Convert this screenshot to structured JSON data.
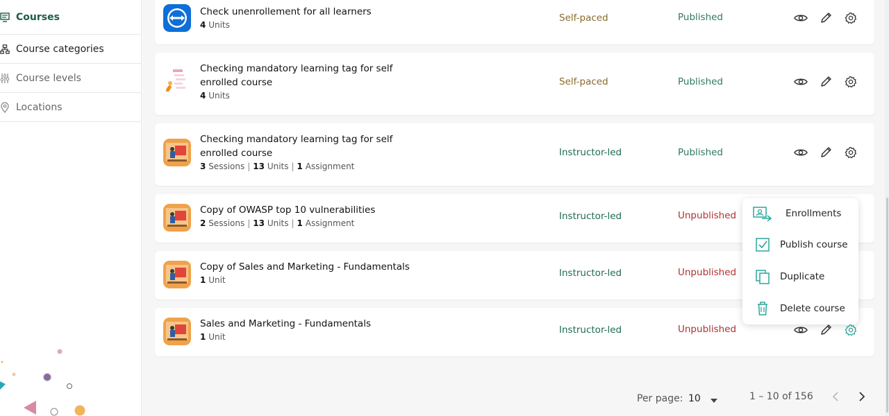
{
  "sidebar": {
    "items": [
      {
        "label": "Courses",
        "icon": "courses-icon",
        "active": true
      },
      {
        "label": "Course categories",
        "icon": "categories-icon"
      },
      {
        "label": "Course levels",
        "icon": "levels-icon"
      },
      {
        "label": "Locations",
        "icon": "location-pin-icon"
      }
    ]
  },
  "courses": [
    {
      "title": "Check unenrollement for all learners",
      "meta": [
        {
          "n": "4",
          "t": "Units"
        }
      ],
      "type": "Self-paced",
      "status": "Published",
      "icon": "teamviewer-logo"
    },
    {
      "title": "Checking mandatory learning tag for self enrolled course",
      "meta": [
        {
          "n": "4",
          "t": "Units"
        }
      ],
      "type": "Self-paced",
      "status": "Published",
      "icon": "document-illustration"
    },
    {
      "title": "Checking mandatory learning tag for self enrolled course",
      "meta": [
        {
          "n": "3",
          "t": "Sessions"
        },
        {
          "n": "13",
          "t": "Units"
        },
        {
          "n": "1",
          "t": "Assignment"
        }
      ],
      "type": "Instructor-led",
      "status": "Published",
      "icon": "instructor-illustration"
    },
    {
      "title": "Copy of OWASP top 10 vulnerabilities",
      "meta": [
        {
          "n": "2",
          "t": "Sessions"
        },
        {
          "n": "13",
          "t": "Units"
        },
        {
          "n": "1",
          "t": "Assignment"
        }
      ],
      "type": "Instructor-led",
      "status": "Unpublished",
      "icon": "instructor-illustration"
    },
    {
      "title": "Copy of Sales and Marketing - Fundamentals",
      "meta": [
        {
          "n": "1",
          "t": "Unit"
        }
      ],
      "type": "Instructor-led",
      "status": "Unpublished",
      "icon": "instructor-illustration"
    },
    {
      "title": "Sales and Marketing - Fundamentals",
      "meta": [
        {
          "n": "1",
          "t": "Unit"
        }
      ],
      "type": "Instructor-led",
      "status": "Unpublished",
      "icon": "instructor-illustration"
    }
  ],
  "row_actions": {
    "view": "eye-icon",
    "edit": "pencil-icon",
    "settings": "gear-icon"
  },
  "menu": {
    "items": [
      {
        "label": "Enrollments",
        "icon": "enrollments-icon"
      },
      {
        "label": "Publish course",
        "icon": "checkbox-icon"
      },
      {
        "label": "Duplicate",
        "icon": "duplicate-icon"
      },
      {
        "label": "Delete course",
        "icon": "trash-icon"
      }
    ]
  },
  "pagination": {
    "per_page_label": "Per page:",
    "per_page_value": "10",
    "range": "1 – 10 of 156"
  },
  "colors": {
    "accent": "#1c5b4a",
    "self_paced": "#8a6a2a",
    "instructor_led": "#1f6a52",
    "published": "#2f7a5c",
    "unpublished": "#b03030",
    "menu_icon": "#2aa79b"
  }
}
